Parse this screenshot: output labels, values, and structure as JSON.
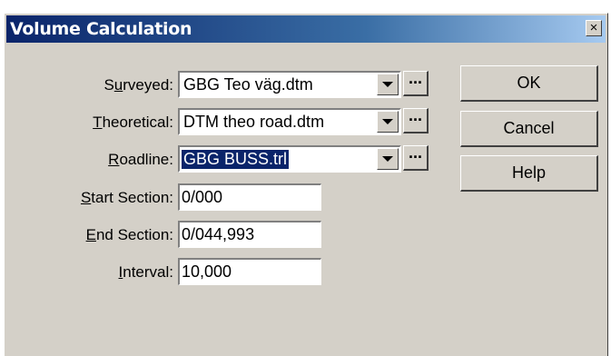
{
  "window": {
    "title": "Volume Calculation",
    "close_label": "×"
  },
  "fields": {
    "surveyed": {
      "label_pre": "S",
      "label_u": "u",
      "label_post": "rveyed:",
      "value": "GBG Teo väg.dtm"
    },
    "theoretical": {
      "label_pre": "",
      "label_u": "T",
      "label_post": "heoretical:",
      "value": "DTM theo road.dtm"
    },
    "roadline": {
      "label_pre": "",
      "label_u": "R",
      "label_post": "oadline:",
      "value": "GBG BUSS.trl"
    },
    "start_section": {
      "label_pre": "",
      "label_u": "S",
      "label_post": "tart Section:",
      "value": "0/000"
    },
    "end_section": {
      "label_pre": "",
      "label_u": "E",
      "label_post": "nd Section:",
      "value": "0/044,993"
    },
    "interval": {
      "label_pre": "",
      "label_u": "I",
      "label_post": "nterval:",
      "value": "10,000"
    }
  },
  "browse_label": "...",
  "buttons": {
    "ok": "OK",
    "cancel": "Cancel",
    "help": "Help"
  }
}
